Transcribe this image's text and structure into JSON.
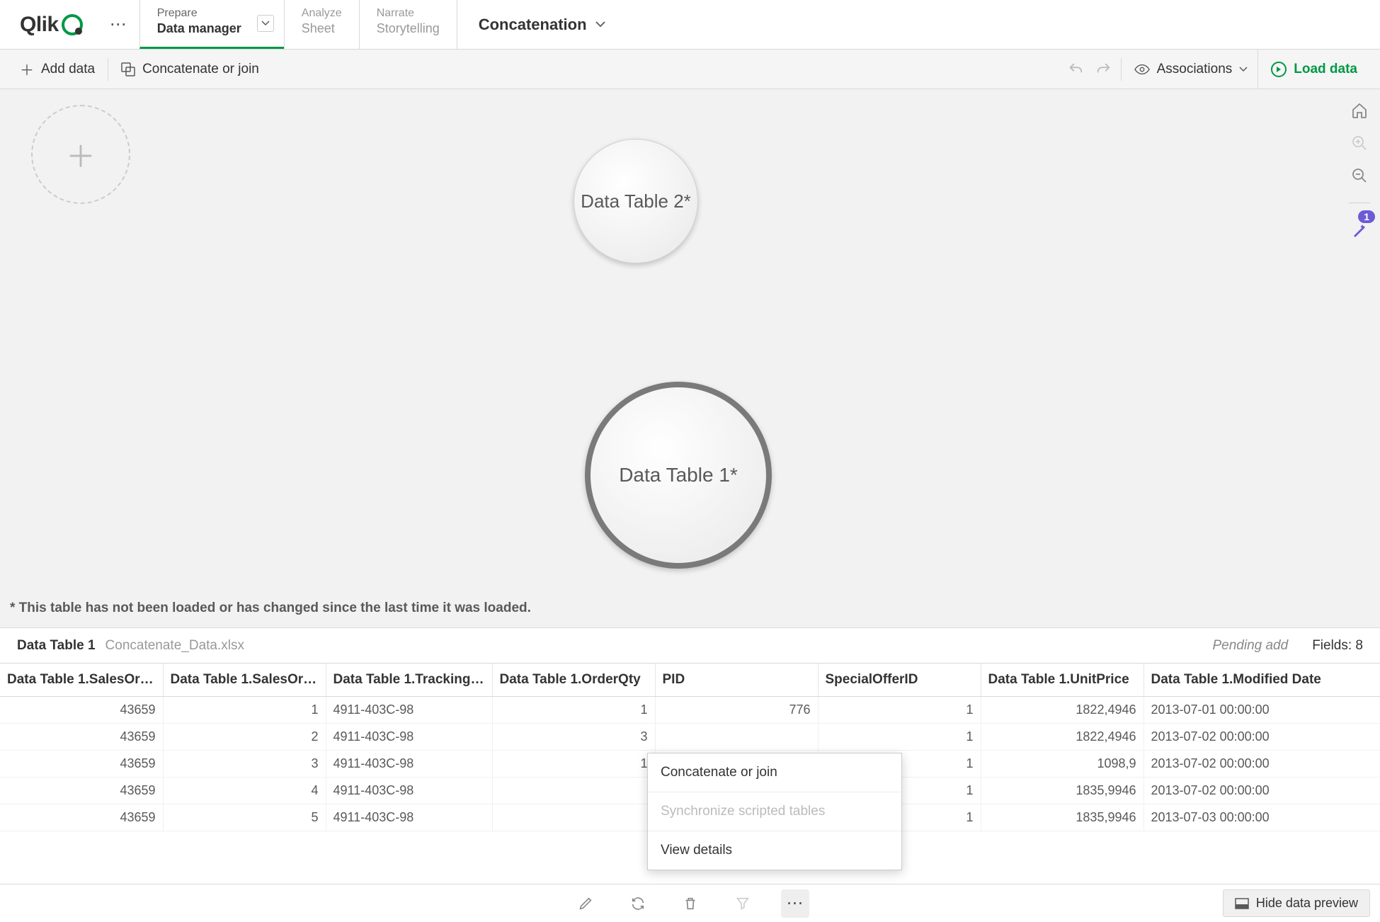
{
  "nav": {
    "logo": "Qlik",
    "tabs": [
      {
        "small": "Prepare",
        "big": "Data manager",
        "active": true,
        "chevron": true
      },
      {
        "small": "Analyze",
        "big": "Sheet",
        "active": false
      },
      {
        "small": "Narrate",
        "big": "Storytelling",
        "active": false
      }
    ],
    "app_title": "Concatenation"
  },
  "subbar": {
    "add_data": "Add data",
    "concat": "Concatenate or join",
    "associations": "Associations",
    "load_data": "Load data"
  },
  "canvas": {
    "bubble_small": "Data Table 2*",
    "bubble_big": "Data Table 1*",
    "footnote": "* This table has not been loaded or has changed since the last time it was loaded.",
    "magic_count": "1"
  },
  "preview": {
    "table_name": "Data Table 1",
    "source": "Concatenate_Data.xlsx",
    "pending": "Pending add",
    "fields_label": "Fields: 8"
  },
  "table": {
    "columns": [
      "Data Table 1.SalesOr…",
      "Data Table 1.SalesOr…",
      "Data Table 1.Tracking…",
      "Data Table 1.OrderQty",
      "PID",
      "SpecialOfferID",
      "Data Table 1.UnitPrice",
      "Data Table 1.Modified Date"
    ],
    "col_align": [
      "num",
      "num",
      "txt",
      "num",
      "num",
      "num",
      "num",
      "txt"
    ],
    "rows": [
      [
        "43659",
        "1",
        "4911-403C-98",
        "1",
        "776",
        "1",
        "1822,4946",
        "2013-07-01 00:00:00"
      ],
      [
        "43659",
        "2",
        "4911-403C-98",
        "3",
        "",
        "1",
        "1822,4946",
        "2013-07-02 00:00:00"
      ],
      [
        "43659",
        "3",
        "4911-403C-98",
        "1",
        "",
        "1",
        "1098,9",
        "2013-07-02 00:00:00"
      ],
      [
        "43659",
        "4",
        "4911-403C-98",
        "",
        "",
        "1",
        "1835,9946",
        "2013-07-02 00:00:00"
      ],
      [
        "43659",
        "5",
        "4911-403C-98",
        "",
        "",
        "1",
        "1835,9946",
        "2013-07-03 00:00:00"
      ]
    ]
  },
  "context_menu": {
    "items": [
      {
        "label": "Concatenate or join",
        "disabled": false
      },
      {
        "label": "Synchronize scripted tables",
        "disabled": true
      },
      {
        "label": "View details",
        "disabled": false
      }
    ]
  },
  "bottom": {
    "hide_preview": "Hide data preview"
  }
}
